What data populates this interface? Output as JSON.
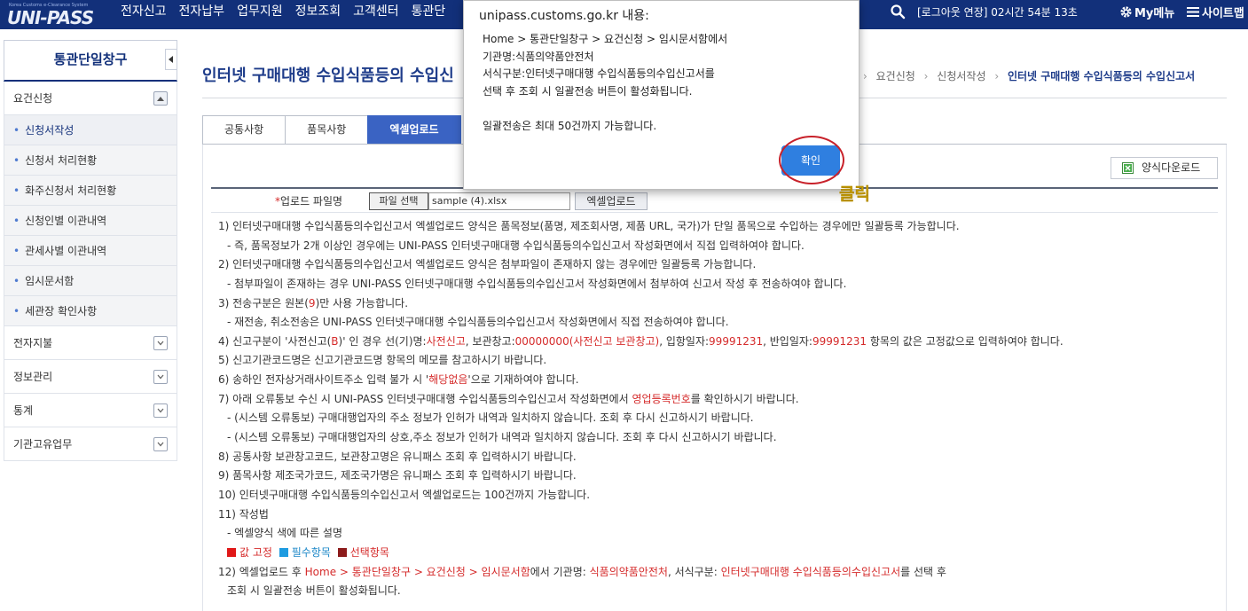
{
  "header": {
    "logo_tagline": "Korea Customs e-Clearance System",
    "logo_text": "UNI-PASS",
    "nav": [
      "전자신고",
      "전자납부",
      "업무지원",
      "정보조회",
      "고객센터",
      "통관단"
    ],
    "session_text": "[로그아웃 연장] 02시간 54분 13초",
    "my_menu": "My메뉴",
    "sitemap": "사이트맵"
  },
  "sidebar": {
    "title": "통관단일창구",
    "section_open": "요건신청",
    "sub_items": [
      "신청서작성",
      "신청서 처리현황",
      "화주신청서 처리현황",
      "신청인별 이관내역",
      "관세사별 이관내역",
      "임시문서함",
      "세관장 확인사항"
    ],
    "sections_closed": [
      "전자지불",
      "정보관리",
      "통계",
      "기관고유업무"
    ]
  },
  "page": {
    "title": "인터넷 구매대행 수입식품등의 수입신",
    "breadcrumb": [
      "요건신청",
      "신청서작성",
      "인터넷 구매대행 수입식품등의 수입신고서"
    ]
  },
  "tabs": [
    "공통사항",
    "품목사항",
    "엑셀업로드"
  ],
  "form": {
    "download_label": "양식다운로드",
    "upload_label": "업로드 파일명",
    "file_select": "파일 선택",
    "file_name": "sample (4).xlsx",
    "excel_upload": "엑셀업로드"
  },
  "instructions": {
    "l1": "1) 인터넷구매대행 수입식품등의수입신고서 엑셀업로드 양식은 품목정보(품명, 제조회사명, 제품 URL, 국가)가 단일 품목으로 수입하는 경우에만 일괄등록 가능합니다.",
    "l1a": "- 즉, 품목정보가 2개 이상인 경우에는 UNI-PASS 인터넷구매대행 수입식품등의수입신고서 작성화면에서 직접 입력하여야 합니다.",
    "l2": "2) 인터넷구매대행 수입식품등의수입신고서 엑셀업로드 양식은 첨부파일이 존재하지 않는 경우에만 일괄등록 가능합니다.",
    "l2a": "- 첨부파일이 존재하는 경우 UNI-PASS 인터넷구매대행 수입식품등의수입신고서 작성화면에서 첨부하여 신고서 작성 후 전송하여야 합니다.",
    "l3_pre": "3) 전송구분은 원본(",
    "l3_red": "9",
    "l3_post": ")만 사용 가능합니다.",
    "l3a": "- 재전송, 취소전송은 UNI-PASS 인터넷구매대행 수입식품등의수입신고서 작성화면에서 직접 전송하여야 합니다.",
    "l4_a": "4) 신고구분이 '사전신고(",
    "l4_b": "B",
    "l4_c": ")' 인 경우 선(기)명:",
    "l4_d": "사전신고",
    "l4_e": ", 보관창고:",
    "l4_f": "00000000(사전신고 보관창고)",
    "l4_g": ", 입항일자:",
    "l4_h": "99991231",
    "l4_i": ", 반입일자:",
    "l4_j": "99991231",
    "l4_k": " 항목의 값은 고정값으로 입력하여야 합니다.",
    "l5": "5) 신고기관코드명은 신고기관코드명 항목의 메모를 참고하시기 바랍니다.",
    "l6_pre": "6) 송하인 전자상거래사이트주소 입력 불가 시 '",
    "l6_red": "해당없음",
    "l6_post": "'으로 기재하여야 합니다.",
    "l7_pre": "7) 아래 오류통보 수신 시 UNI-PASS 인터넷구매대행 수입식품등의수입신고서 작성화면에서 ",
    "l7_red": "영업등록번호",
    "l7_post": "를 확인하시기 바랍니다.",
    "l7a": "- (시스템 오류통보) 구매대행업자의 주소 정보가 인허가 내역과 일치하지 않습니다. 조회 후 다시 신고하시기 바랍니다.",
    "l7b": "- (시스템 오류통보) 구매대행업자의 상호,주소 정보가 인허가 내역과 일치하지 않습니다. 조회 후 다시 신고하시기 바랍니다.",
    "l8": "8) 공통사항 보관창고코드, 보관창고명은 유니패스 조회 후 입력하시기 바랍니다.",
    "l9": "9) 품목사항 제조국가코드, 제조국가명은 유니패스 조회 후 입력하시기 바랍니다.",
    "l10": "10) 인터넷구매대행 수입식품등의수입신고서 엑셀업로드는 100건까지 가능합니다.",
    "l11": "11) 작성법",
    "l11a": "- 엑셀양식 색에 따른 설명",
    "legend_fixed": "값 고정",
    "legend_required": "필수항목",
    "legend_optional": "선택항목",
    "l12_a": "12) 엑셀업로드 후 ",
    "l12_b": "Home > 통관단일창구 > 요건신청 > 임시문서함",
    "l12_c": "에서 기관명: ",
    "l12_d": "식품의약품안전처",
    "l12_e": ", 서식구분: ",
    "l12_f": "인터넷구매대행 수입식품등의수입신고서",
    "l12_g": "를 선택 후",
    "l12b": "조회 시 일괄전송 버튼이 활성화됩니다."
  },
  "dialog": {
    "title": "unipass.customs.go.kr 내용:",
    "lines": [
      "Home > 통관단일창구 > 요건신청 > 임시문서함에서",
      "기관명:식품의약품안전처",
      "서식구분:인터넷구매대행 수입식품등의수입신고서를",
      "선택 후 조회 시 일괄전송 버튼이 활성화됩니다.",
      "",
      "일괄전송은 최대  50건까지 가능합니다."
    ],
    "ok": "확인"
  },
  "annotation": {
    "click_label": "클릭"
  },
  "colors": {
    "header_bg": "#12307a",
    "accent": "#3a63c3",
    "dialog_button": "#2f7fe0",
    "highlight_red": "#d52b2b",
    "annotation_circle": "#c8212a",
    "annotation_text": "#e6b800"
  }
}
